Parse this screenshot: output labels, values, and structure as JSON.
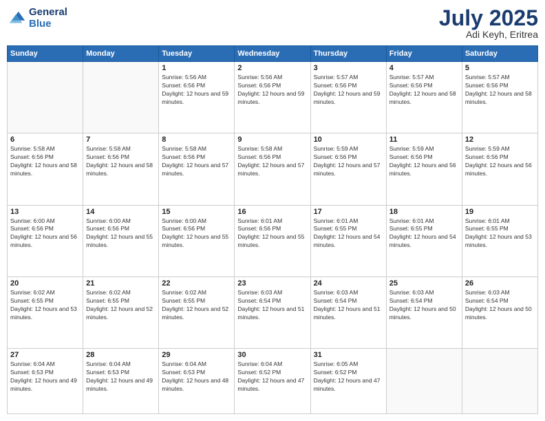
{
  "logo": {
    "line1": "General",
    "line2": "Blue"
  },
  "title": "July 2025",
  "subtitle": "Adi Keyh, Eritrea",
  "headers": [
    "Sunday",
    "Monday",
    "Tuesday",
    "Wednesday",
    "Thursday",
    "Friday",
    "Saturday"
  ],
  "weeks": [
    [
      {
        "day": "",
        "info": ""
      },
      {
        "day": "",
        "info": ""
      },
      {
        "day": "1",
        "info": "Sunrise: 5:56 AM\nSunset: 6:56 PM\nDaylight: 12 hours and 59 minutes."
      },
      {
        "day": "2",
        "info": "Sunrise: 5:56 AM\nSunset: 6:56 PM\nDaylight: 12 hours and 59 minutes."
      },
      {
        "day": "3",
        "info": "Sunrise: 5:57 AM\nSunset: 6:56 PM\nDaylight: 12 hours and 59 minutes."
      },
      {
        "day": "4",
        "info": "Sunrise: 5:57 AM\nSunset: 6:56 PM\nDaylight: 12 hours and 58 minutes."
      },
      {
        "day": "5",
        "info": "Sunrise: 5:57 AM\nSunset: 6:56 PM\nDaylight: 12 hours and 58 minutes."
      }
    ],
    [
      {
        "day": "6",
        "info": "Sunrise: 5:58 AM\nSunset: 6:56 PM\nDaylight: 12 hours and 58 minutes."
      },
      {
        "day": "7",
        "info": "Sunrise: 5:58 AM\nSunset: 6:56 PM\nDaylight: 12 hours and 58 minutes."
      },
      {
        "day": "8",
        "info": "Sunrise: 5:58 AM\nSunset: 6:56 PM\nDaylight: 12 hours and 57 minutes."
      },
      {
        "day": "9",
        "info": "Sunrise: 5:58 AM\nSunset: 6:56 PM\nDaylight: 12 hours and 57 minutes."
      },
      {
        "day": "10",
        "info": "Sunrise: 5:59 AM\nSunset: 6:56 PM\nDaylight: 12 hours and 57 minutes."
      },
      {
        "day": "11",
        "info": "Sunrise: 5:59 AM\nSunset: 6:56 PM\nDaylight: 12 hours and 56 minutes."
      },
      {
        "day": "12",
        "info": "Sunrise: 5:59 AM\nSunset: 6:56 PM\nDaylight: 12 hours and 56 minutes."
      }
    ],
    [
      {
        "day": "13",
        "info": "Sunrise: 6:00 AM\nSunset: 6:56 PM\nDaylight: 12 hours and 56 minutes."
      },
      {
        "day": "14",
        "info": "Sunrise: 6:00 AM\nSunset: 6:56 PM\nDaylight: 12 hours and 55 minutes."
      },
      {
        "day": "15",
        "info": "Sunrise: 6:00 AM\nSunset: 6:56 PM\nDaylight: 12 hours and 55 minutes."
      },
      {
        "day": "16",
        "info": "Sunrise: 6:01 AM\nSunset: 6:56 PM\nDaylight: 12 hours and 55 minutes."
      },
      {
        "day": "17",
        "info": "Sunrise: 6:01 AM\nSunset: 6:55 PM\nDaylight: 12 hours and 54 minutes."
      },
      {
        "day": "18",
        "info": "Sunrise: 6:01 AM\nSunset: 6:55 PM\nDaylight: 12 hours and 54 minutes."
      },
      {
        "day": "19",
        "info": "Sunrise: 6:01 AM\nSunset: 6:55 PM\nDaylight: 12 hours and 53 minutes."
      }
    ],
    [
      {
        "day": "20",
        "info": "Sunrise: 6:02 AM\nSunset: 6:55 PM\nDaylight: 12 hours and 53 minutes."
      },
      {
        "day": "21",
        "info": "Sunrise: 6:02 AM\nSunset: 6:55 PM\nDaylight: 12 hours and 52 minutes."
      },
      {
        "day": "22",
        "info": "Sunrise: 6:02 AM\nSunset: 6:55 PM\nDaylight: 12 hours and 52 minutes."
      },
      {
        "day": "23",
        "info": "Sunrise: 6:03 AM\nSunset: 6:54 PM\nDaylight: 12 hours and 51 minutes."
      },
      {
        "day": "24",
        "info": "Sunrise: 6:03 AM\nSunset: 6:54 PM\nDaylight: 12 hours and 51 minutes."
      },
      {
        "day": "25",
        "info": "Sunrise: 6:03 AM\nSunset: 6:54 PM\nDaylight: 12 hours and 50 minutes."
      },
      {
        "day": "26",
        "info": "Sunrise: 6:03 AM\nSunset: 6:54 PM\nDaylight: 12 hours and 50 minutes."
      }
    ],
    [
      {
        "day": "27",
        "info": "Sunrise: 6:04 AM\nSunset: 6:53 PM\nDaylight: 12 hours and 49 minutes."
      },
      {
        "day": "28",
        "info": "Sunrise: 6:04 AM\nSunset: 6:53 PM\nDaylight: 12 hours and 49 minutes."
      },
      {
        "day": "29",
        "info": "Sunrise: 6:04 AM\nSunset: 6:53 PM\nDaylight: 12 hours and 48 minutes."
      },
      {
        "day": "30",
        "info": "Sunrise: 6:04 AM\nSunset: 6:52 PM\nDaylight: 12 hours and 47 minutes."
      },
      {
        "day": "31",
        "info": "Sunrise: 6:05 AM\nSunset: 6:52 PM\nDaylight: 12 hours and 47 minutes."
      },
      {
        "day": "",
        "info": ""
      },
      {
        "day": "",
        "info": ""
      }
    ]
  ]
}
